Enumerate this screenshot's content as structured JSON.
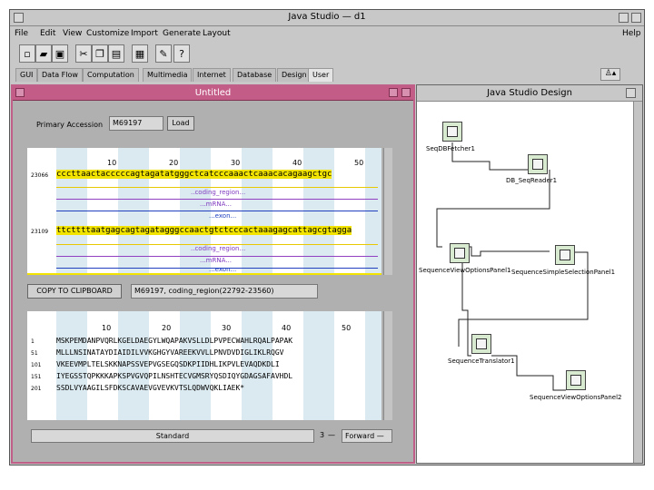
{
  "app": {
    "title": "Java Studio — d1",
    "menu": [
      "File",
      "Edit",
      "View",
      "Customize",
      "Import",
      "Generate",
      "Layout"
    ],
    "help": "Help",
    "tabs": [
      "GUI",
      "Data Flow",
      "Computation",
      "Multimedia",
      "Internet",
      "Database",
      "Design",
      "User"
    ]
  },
  "untitled": {
    "title": "Untitled",
    "accession_label": "Primary Accession",
    "accession_value": "M69197",
    "load_label": "Load",
    "ruler": [
      "10",
      "20",
      "30",
      "40",
      "50"
    ],
    "seq_rows": [
      {
        "pos": "23066",
        "seq": "cccttaactacccccagtagatatgggctcatcccaaactcaaacacagaagctgc"
      },
      {
        "pos": "23109",
        "seq": "ttcttttaatgagcagtagatagggccaactgtctcccactaaagagcattagcgtagga"
      }
    ],
    "features": [
      "..coding_region...",
      "...mRNA...",
      "...exon...",
      "..coding_region...",
      "...mRNA...",
      "...exon..."
    ],
    "copy_label": "COPY TO CLIPBOARD",
    "copy_value": "M69197, coding_region(22792-23560)",
    "prot_ruler": [
      "10",
      "20",
      "30",
      "40",
      "50"
    ],
    "prot_rows": [
      {
        "pos": "1",
        "seq": "MSKPEMDANPVQRLKGELDAEGYLWQAPAKVSLLDLPVPECWAHLRQALPAPAK"
      },
      {
        "pos": "51",
        "seq": "MLLLNSINATAYDIAIDILVVKGHGYVAREEKVVLLPNVDVDIGLIKLRQGV"
      },
      {
        "pos": "101",
        "seq": "VKEEVMPLTELSKKNAPSSVEPVGSEGQSDKPIIDHLIKPVLEVAQDKDLI"
      },
      {
        "pos": "151",
        "seq": "IYEGSSTQPKKKAPKSPVGVQPILNSHTECVGMSRYQSDIQYGDAGSAFAVHDL"
      },
      {
        "pos": "201",
        "seq": "SSDLVYAAGILSFDKSCAVAEVGVEVKVTSLQDWVQKLIAEK*"
      }
    ],
    "frame_value": "Standard",
    "frame_num": "3",
    "direction_value": "Forward"
  },
  "design": {
    "title": "Java Studio Design",
    "nodes": [
      "SeqDBFetcher1",
      "DB_SeqReader1",
      "SequenceViewOptionsPanel1",
      "SequenceSimpleSelectionPanel1",
      "SequenceTranslator1",
      "SequenceViewOptionsPanel2"
    ]
  }
}
